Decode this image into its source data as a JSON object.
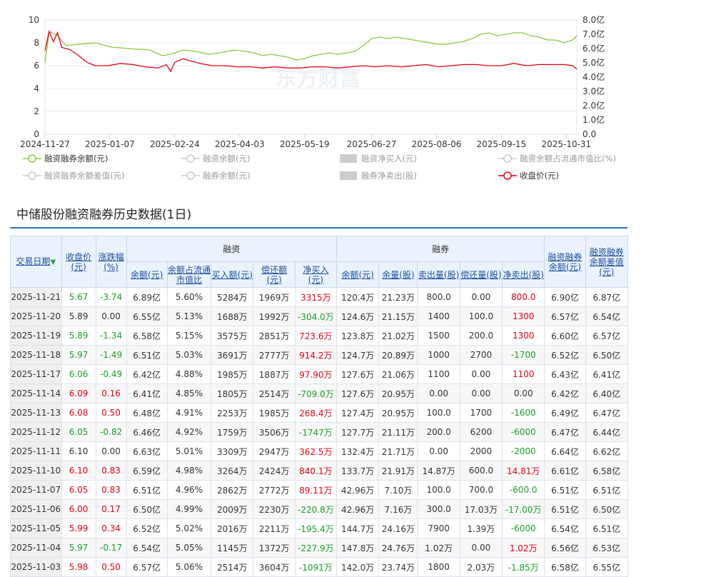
{
  "chart_data": {
    "type": "line",
    "x_dates": [
      "2024-11-27",
      "2025-01-07",
      "2025-02-24",
      "2025-04-03",
      "2025-05-19",
      "2025-06-27",
      "2025-08-06",
      "2025-09-15",
      "2025-10-31"
    ],
    "y_left_ticks": [
      "0",
      "2",
      "4",
      "6",
      "8",
      "10"
    ],
    "y_left_range": [
      0,
      10
    ],
    "y_right_ticks": [
      "0.0",
      "1.0亿",
      "2.0亿",
      "3.0亿",
      "4.0亿",
      "5.0亿",
      "6.0亿",
      "7.0亿",
      "8.0亿"
    ],
    "y_right_range": [
      0,
      8
    ],
    "watermark": "东方财富",
    "series": [
      {
        "name": "融资融券余额(元)",
        "axis": "right",
        "color": "#8cc63f",
        "points": [
          [
            0,
            5.0
          ],
          [
            1,
            7.2
          ],
          [
            3,
            6.9
          ],
          [
            5,
            6.2
          ],
          [
            8,
            6.3
          ],
          [
            12,
            6.4
          ],
          [
            16,
            6.1
          ],
          [
            20,
            6.0
          ],
          [
            25,
            5.9
          ],
          [
            28,
            5.5
          ],
          [
            30,
            5.6
          ],
          [
            33,
            5.9
          ],
          [
            36,
            5.8
          ],
          [
            39,
            5.6
          ],
          [
            42,
            5.7
          ],
          [
            45,
            5.9
          ],
          [
            48,
            5.8
          ],
          [
            50,
            5.7
          ],
          [
            52,
            5.5
          ],
          [
            54,
            5.6
          ],
          [
            56,
            5.5
          ],
          [
            58,
            5.4
          ],
          [
            60,
            5.2
          ],
          [
            62,
            5.3
          ],
          [
            64,
            5.5
          ],
          [
            66,
            5.6
          ],
          [
            68,
            5.7
          ],
          [
            70,
            5.6
          ],
          [
            72,
            5.7
          ],
          [
            74,
            5.8
          ],
          [
            76,
            6.2
          ],
          [
            78,
            6.7
          ],
          [
            80,
            6.8
          ],
          [
            82,
            6.7
          ],
          [
            84,
            6.8
          ],
          [
            86,
            6.7
          ],
          [
            88,
            6.6
          ],
          [
            90,
            6.5
          ],
          [
            92,
            6.4
          ],
          [
            94,
            6.3
          ],
          [
            96,
            6.3
          ],
          [
            98,
            6.4
          ],
          [
            100,
            6.5
          ],
          [
            102,
            6.7
          ],
          [
            104,
            7.0
          ],
          [
            106,
            7.1
          ],
          [
            108,
            6.9
          ],
          [
            110,
            7.0
          ],
          [
            112,
            7.1
          ],
          [
            114,
            7.1
          ],
          [
            116,
            6.9
          ],
          [
            118,
            6.8
          ],
          [
            120,
            6.6
          ],
          [
            122,
            6.6
          ],
          [
            124,
            6.4
          ],
          [
            126,
            6.6
          ],
          [
            127,
            6.9
          ]
        ]
      },
      {
        "name": "收盘价(元)",
        "axis": "left",
        "color": "#e60012",
        "points": [
          [
            0,
            7.3
          ],
          [
            1,
            9.0
          ],
          [
            2,
            8.1
          ],
          [
            3,
            8.9
          ],
          [
            4,
            7.6
          ],
          [
            6,
            7.4
          ],
          [
            8,
            6.9
          ],
          [
            10,
            6.3
          ],
          [
            12,
            6.0
          ],
          [
            15,
            6.0
          ],
          [
            18,
            6.2
          ],
          [
            21,
            6.1
          ],
          [
            24,
            5.9
          ],
          [
            27,
            5.8
          ],
          [
            29,
            6.1
          ],
          [
            30,
            5.5
          ],
          [
            31,
            6.3
          ],
          [
            33,
            6.6
          ],
          [
            35,
            6.4
          ],
          [
            37,
            6.2
          ],
          [
            40,
            6.0
          ],
          [
            43,
            6.0
          ],
          [
            46,
            5.9
          ],
          [
            49,
            5.9
          ],
          [
            52,
            5.8
          ],
          [
            55,
            5.9
          ],
          [
            58,
            5.8
          ],
          [
            61,
            5.8
          ],
          [
            64,
            5.9
          ],
          [
            67,
            5.9
          ],
          [
            70,
            5.8
          ],
          [
            73,
            5.9
          ],
          [
            76,
            6.0
          ],
          [
            79,
            5.9
          ],
          [
            82,
            6.0
          ],
          [
            85,
            5.9
          ],
          [
            88,
            6.0
          ],
          [
            91,
            6.1
          ],
          [
            94,
            5.9
          ],
          [
            97,
            6.0
          ],
          [
            100,
            6.1
          ],
          [
            103,
            6.1
          ],
          [
            106,
            6.0
          ],
          [
            109,
            6.0
          ],
          [
            112,
            6.2
          ],
          [
            115,
            6.0
          ],
          [
            118,
            6.1
          ],
          [
            121,
            6.1
          ],
          [
            124,
            6.1
          ],
          [
            126,
            6.0
          ],
          [
            127,
            5.7
          ]
        ]
      }
    ],
    "legend": [
      {
        "label": "融资融券余额(元)",
        "kind": "line",
        "color": "#8cc63f",
        "active": true
      },
      {
        "label": "融资余额(元)",
        "kind": "line",
        "color": "#cccccc",
        "active": false
      },
      {
        "label": "融资净买入(元)",
        "kind": "box",
        "color": "#cccccc",
        "active": false
      },
      {
        "label": "融资余额占流通市值比(%)",
        "kind": "line",
        "color": "#cccccc",
        "active": false
      },
      {
        "label": "融资融券余额差值(元)",
        "kind": "line",
        "color": "#cccccc",
        "active": false
      },
      {
        "label": "融券余额(元)",
        "kind": "line",
        "color": "#cccccc",
        "active": false
      },
      {
        "label": "融券净卖出(股)",
        "kind": "box",
        "color": "#cccccc",
        "active": false
      },
      {
        "label": "收盘价(元)",
        "kind": "line",
        "color": "#e60012",
        "active": true
      }
    ]
  },
  "section": {
    "title": "中储股份融资融券历史数据(1日)"
  },
  "table": {
    "headers": {
      "date": "交易日期",
      "close": "收盘价(元)",
      "change": "涨跌幅(%)",
      "rz_group": "融资",
      "rq_group": "融券",
      "total": "融资融券余额(元)",
      "diff": "融资融券余额差值(元)",
      "rz": [
        "余额(元)",
        "余额占流通市值比",
        "买入额(元)",
        "偿还额(元)",
        "净买入(元)"
      ],
      "rq": [
        "余额(元)",
        "余量(股)",
        "卖出量(股)",
        "偿还量(股)",
        "净卖出(股)"
      ]
    },
    "rows": [
      {
        "date": "2025-11-21",
        "close": "5.67",
        "chg": "-3.74",
        "rz_bal": "6.89亿",
        "rz_pct": "5.60%",
        "rz_buy": "5284万",
        "rz_repay": "1969万",
        "rz_net": "3315万",
        "rq_bal": "120.4万",
        "rq_vol": "21.23万",
        "rq_sell": "800.0",
        "rq_repay": "0.00",
        "rq_net": "800.0",
        "total": "6.90亿",
        "diff": "6.87亿",
        "up": false,
        "netpos": true,
        "rqneg": false
      },
      {
        "date": "2025-11-20",
        "close": "5.89",
        "chg": "0.00",
        "rz_bal": "6.55亿",
        "rz_pct": "5.13%",
        "rz_buy": "1688万",
        "rz_repay": "1992万",
        "rz_net": "-304.0万",
        "rq_bal": "124.6万",
        "rq_vol": "21.15万",
        "rq_sell": "1400",
        "rq_repay": "100.0",
        "rq_net": "1300",
        "total": "6.57亿",
        "diff": "6.54亿",
        "up": null,
        "netpos": false,
        "rqneg": false
      },
      {
        "date": "2025-11-19",
        "close": "5.89",
        "chg": "-1.34",
        "rz_bal": "6.58亿",
        "rz_pct": "5.15%",
        "rz_buy": "3575万",
        "rz_repay": "2851万",
        "rz_net": "723.6万",
        "rq_bal": "123.8万",
        "rq_vol": "21.02万",
        "rq_sell": "1500",
        "rq_repay": "200.0",
        "rq_net": "1300",
        "total": "6.60亿",
        "diff": "6.57亿",
        "up": false,
        "netpos": true,
        "rqneg": false
      },
      {
        "date": "2025-11-18",
        "close": "5.97",
        "chg": "-1.49",
        "rz_bal": "6.51亿",
        "rz_pct": "5.03%",
        "rz_buy": "3691万",
        "rz_repay": "2777万",
        "rz_net": "914.2万",
        "rq_bal": "124.7万",
        "rq_vol": "20.89万",
        "rq_sell": "1000",
        "rq_repay": "2700",
        "rq_net": "-1700",
        "total": "6.52亿",
        "diff": "6.50亿",
        "up": false,
        "netpos": true,
        "rqneg": true
      },
      {
        "date": "2025-11-17",
        "close": "6.06",
        "chg": "-0.49",
        "rz_bal": "6.42亿",
        "rz_pct": "4.88%",
        "rz_buy": "1985万",
        "rz_repay": "1887万",
        "rz_net": "97.90万",
        "rq_bal": "127.6万",
        "rq_vol": "21.06万",
        "rq_sell": "1100",
        "rq_repay": "0.00",
        "rq_net": "1100",
        "total": "6.43亿",
        "diff": "6.41亿",
        "up": false,
        "netpos": true,
        "rqneg": false
      },
      {
        "date": "2025-11-14",
        "close": "6.09",
        "chg": "0.16",
        "rz_bal": "6.41亿",
        "rz_pct": "4.85%",
        "rz_buy": "1805万",
        "rz_repay": "2514万",
        "rz_net": "-709.0万",
        "rq_bal": "127.6万",
        "rq_vol": "20.95万",
        "rq_sell": "0.00",
        "rq_repay": "0.00",
        "rq_net": "0.00",
        "total": "6.42亿",
        "diff": "6.40亿",
        "up": true,
        "netpos": false,
        "rqneg": null
      },
      {
        "date": "2025-11-13",
        "close": "6.08",
        "chg": "0.50",
        "rz_bal": "6.48亿",
        "rz_pct": "4.91%",
        "rz_buy": "2253万",
        "rz_repay": "1985万",
        "rz_net": "268.4万",
        "rq_bal": "127.4万",
        "rq_vol": "20.95万",
        "rq_sell": "100.0",
        "rq_repay": "1700",
        "rq_net": "-1600",
        "total": "6.49亿",
        "diff": "6.47亿",
        "up": true,
        "netpos": true,
        "rqneg": true
      },
      {
        "date": "2025-11-12",
        "close": "6.05",
        "chg": "-0.82",
        "rz_bal": "6.46亿",
        "rz_pct": "4.92%",
        "rz_buy": "1759万",
        "rz_repay": "3506万",
        "rz_net": "-1747万",
        "rq_bal": "127.7万",
        "rq_vol": "21.11万",
        "rq_sell": "200.0",
        "rq_repay": "6200",
        "rq_net": "-6000",
        "total": "6.47亿",
        "diff": "6.44亿",
        "up": false,
        "netpos": false,
        "rqneg": true
      },
      {
        "date": "2025-11-11",
        "close": "6.10",
        "chg": "0.00",
        "rz_bal": "6.63亿",
        "rz_pct": "5.01%",
        "rz_buy": "3309万",
        "rz_repay": "2947万",
        "rz_net": "362.5万",
        "rq_bal": "132.4万",
        "rq_vol": "21.71万",
        "rq_sell": "0.00",
        "rq_repay": "2000",
        "rq_net": "-2000",
        "total": "6.64亿",
        "diff": "6.62亿",
        "up": null,
        "netpos": true,
        "rqneg": true
      },
      {
        "date": "2025-11-10",
        "close": "6.10",
        "chg": "0.83",
        "rz_bal": "6.59亿",
        "rz_pct": "4.98%",
        "rz_buy": "3264万",
        "rz_repay": "2424万",
        "rz_net": "840.1万",
        "rq_bal": "133.7万",
        "rq_vol": "21.91万",
        "rq_sell": "14.87万",
        "rq_repay": "600.0",
        "rq_net": "14.81万",
        "total": "6.61亿",
        "diff": "6.58亿",
        "up": true,
        "netpos": true,
        "rqneg": false
      },
      {
        "date": "2025-11-07",
        "close": "6.05",
        "chg": "0.83",
        "rz_bal": "6.51亿",
        "rz_pct": "4.96%",
        "rz_buy": "2862万",
        "rz_repay": "2772万",
        "rz_net": "89.11万",
        "rq_bal": "42.96万",
        "rq_vol": "7.10万",
        "rq_sell": "100.0",
        "rq_repay": "700.0",
        "rq_net": "-600.0",
        "total": "6.51亿",
        "diff": "6.51亿",
        "up": true,
        "netpos": true,
        "rqneg": true
      },
      {
        "date": "2025-11-06",
        "close": "6.00",
        "chg": "0.17",
        "rz_bal": "6.50亿",
        "rz_pct": "4.99%",
        "rz_buy": "2009万",
        "rz_repay": "2230万",
        "rz_net": "-220.8万",
        "rq_bal": "42.96万",
        "rq_vol": "7.16万",
        "rq_sell": "300.0",
        "rq_repay": "17.03万",
        "rq_net": "-17.00万",
        "total": "6.51亿",
        "diff": "6.50亿",
        "up": true,
        "netpos": false,
        "rqneg": true
      },
      {
        "date": "2025-11-05",
        "close": "5.99",
        "chg": "0.34",
        "rz_bal": "6.52亿",
        "rz_pct": "5.02%",
        "rz_buy": "2016万",
        "rz_repay": "2211万",
        "rz_net": "-195.4万",
        "rq_bal": "144.7万",
        "rq_vol": "24.16万",
        "rq_sell": "7900",
        "rq_repay": "1.39万",
        "rq_net": "-6000",
        "total": "6.54亿",
        "diff": "6.51亿",
        "up": true,
        "netpos": false,
        "rqneg": true
      },
      {
        "date": "2025-11-04",
        "close": "5.97",
        "chg": "-0.17",
        "rz_bal": "6.54亿",
        "rz_pct": "5.05%",
        "rz_buy": "1145万",
        "rz_repay": "1372万",
        "rz_net": "-227.9万",
        "rq_bal": "147.8万",
        "rq_vol": "24.76万",
        "rq_sell": "1.02万",
        "rq_repay": "0.00",
        "rq_net": "1.02万",
        "total": "6.56亿",
        "diff": "6.53亿",
        "up": false,
        "netpos": false,
        "rqneg": false
      },
      {
        "date": "2025-11-03",
        "close": "5.98",
        "chg": "0.50",
        "rz_bal": "6.57亿",
        "rz_pct": "5.06%",
        "rz_buy": "2514万",
        "rz_repay": "3604万",
        "rz_net": "-1091万",
        "rq_bal": "142.0万",
        "rq_vol": "23.74万",
        "rq_sell": "1800",
        "rq_repay": "2.03万",
        "rq_net": "-1.85万",
        "total": "6.58亿",
        "diff": "6.55亿",
        "up": true,
        "netpos": false,
        "rqneg": true
      }
    ]
  }
}
